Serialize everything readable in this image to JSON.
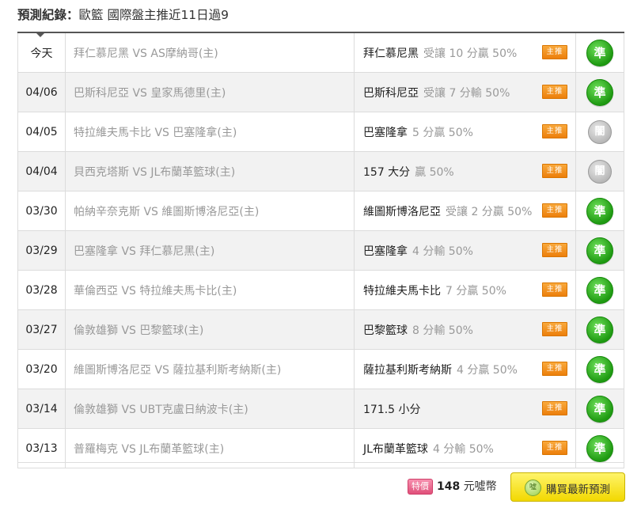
{
  "header": {
    "label": "預測紀錄：",
    "title": "歐籃 國際盤主推近11日過9"
  },
  "rows": [
    {
      "date": "今天",
      "match": "拜仁慕尼黑 VS AS摩納哥(主)",
      "pick": "拜仁慕尼黑",
      "detail": "受讓 10 分贏 50%",
      "tag": "主推",
      "result": "準",
      "result_type": "win"
    },
    {
      "date": "04/06",
      "match": "巴斯科尼亞 VS 皇家馬德里(主)",
      "pick": "巴斯科尼亞",
      "detail": "受讓 7 分輸 50%",
      "tag": "主推",
      "result": "準",
      "result_type": "win"
    },
    {
      "date": "04/05",
      "match": "特拉維夫馬卡比 VS 巴塞隆拿(主)",
      "pick": "巴塞隆拿",
      "detail": "5 分贏 50%",
      "tag": "主推",
      "result": "闇",
      "result_type": "push"
    },
    {
      "date": "04/04",
      "match": "貝西克塔斯 VS JL布蘭革籃球(主)",
      "pick": "157 大分",
      "detail": "贏 50%",
      "tag": "主推",
      "result": "闇",
      "result_type": "push"
    },
    {
      "date": "03/30",
      "match": "帕納辛奈克斯 VS 維圖斯博洛尼亞(主)",
      "pick": "維圖斯博洛尼亞",
      "detail": "受讓 2 分贏 50%",
      "tag": "主推",
      "result": "準",
      "result_type": "win"
    },
    {
      "date": "03/29",
      "match": "巴塞隆拿 VS 拜仁慕尼黑(主)",
      "pick": "巴塞隆拿",
      "detail": "4 分輸 50%",
      "tag": "主推",
      "result": "準",
      "result_type": "win"
    },
    {
      "date": "03/28",
      "match": "華倫西亞 VS 特拉維夫馬卡比(主)",
      "pick": "特拉維夫馬卡比",
      "detail": "7 分贏 50%",
      "tag": "主推",
      "result": "準",
      "result_type": "win"
    },
    {
      "date": "03/27",
      "match": "倫敦雄獅 VS 巴黎籃球(主)",
      "pick": "巴黎籃球",
      "detail": "8 分輸 50%",
      "tag": "主推",
      "result": "準",
      "result_type": "win"
    },
    {
      "date": "03/20",
      "match": "維圖斯博洛尼亞 VS 薩拉基利斯考納斯(主)",
      "pick": "薩拉基利斯考納斯",
      "detail": "4 分贏 50%",
      "tag": "主推",
      "result": "準",
      "result_type": "win"
    },
    {
      "date": "03/14",
      "match": "倫敦雄獅 VS UBT克盧日納波卡(主)",
      "pick": "171.5 小分",
      "detail": "",
      "tag": "主推",
      "result": "準",
      "result_type": "win"
    },
    {
      "date": "03/13",
      "match": "普羅梅克 VS JL布蘭革籃球(主)",
      "pick": "JL布蘭革籃球",
      "detail": "4 分輸 50%",
      "tag": "主推",
      "result": "準",
      "result_type": "win"
    }
  ],
  "footer": {
    "special_label": "特價",
    "price": "148",
    "unit": "元噓幣",
    "coin_icon_text": "噓",
    "buy_label": "購買最新預測"
  },
  "colors": {
    "win": "#1f9a12",
    "push": "#b5b5b5",
    "tag": "#ec7f0b",
    "buy_button": "#f2d800"
  }
}
